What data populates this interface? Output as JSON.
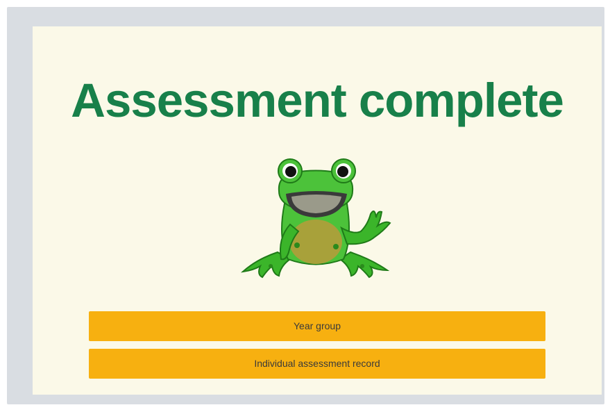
{
  "screen": {
    "title": "Assessment complete",
    "mascot_icon": "frog-waving-icon"
  },
  "buttons": {
    "year_group": "Year group",
    "individual_record": "Individual assessment record"
  },
  "colors": {
    "title": "#18804a",
    "card_background": "#fbf9e8",
    "button": "#f7b010",
    "frame": "#d9dde2"
  }
}
